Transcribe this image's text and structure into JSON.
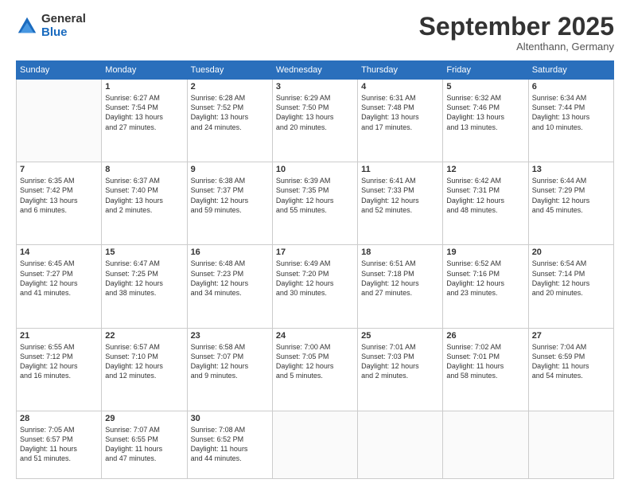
{
  "logo": {
    "general": "General",
    "blue": "Blue"
  },
  "header": {
    "month": "September 2025",
    "location": "Altenthann, Germany"
  },
  "weekdays": [
    "Sunday",
    "Monday",
    "Tuesday",
    "Wednesday",
    "Thursday",
    "Friday",
    "Saturday"
  ],
  "weeks": [
    [
      {
        "day": "",
        "info": ""
      },
      {
        "day": "1",
        "info": "Sunrise: 6:27 AM\nSunset: 7:54 PM\nDaylight: 13 hours\nand 27 minutes."
      },
      {
        "day": "2",
        "info": "Sunrise: 6:28 AM\nSunset: 7:52 PM\nDaylight: 13 hours\nand 24 minutes."
      },
      {
        "day": "3",
        "info": "Sunrise: 6:29 AM\nSunset: 7:50 PM\nDaylight: 13 hours\nand 20 minutes."
      },
      {
        "day": "4",
        "info": "Sunrise: 6:31 AM\nSunset: 7:48 PM\nDaylight: 13 hours\nand 17 minutes."
      },
      {
        "day": "5",
        "info": "Sunrise: 6:32 AM\nSunset: 7:46 PM\nDaylight: 13 hours\nand 13 minutes."
      },
      {
        "day": "6",
        "info": "Sunrise: 6:34 AM\nSunset: 7:44 PM\nDaylight: 13 hours\nand 10 minutes."
      }
    ],
    [
      {
        "day": "7",
        "info": "Sunrise: 6:35 AM\nSunset: 7:42 PM\nDaylight: 13 hours\nand 6 minutes."
      },
      {
        "day": "8",
        "info": "Sunrise: 6:37 AM\nSunset: 7:40 PM\nDaylight: 13 hours\nand 2 minutes."
      },
      {
        "day": "9",
        "info": "Sunrise: 6:38 AM\nSunset: 7:37 PM\nDaylight: 12 hours\nand 59 minutes."
      },
      {
        "day": "10",
        "info": "Sunrise: 6:39 AM\nSunset: 7:35 PM\nDaylight: 12 hours\nand 55 minutes."
      },
      {
        "day": "11",
        "info": "Sunrise: 6:41 AM\nSunset: 7:33 PM\nDaylight: 12 hours\nand 52 minutes."
      },
      {
        "day": "12",
        "info": "Sunrise: 6:42 AM\nSunset: 7:31 PM\nDaylight: 12 hours\nand 48 minutes."
      },
      {
        "day": "13",
        "info": "Sunrise: 6:44 AM\nSunset: 7:29 PM\nDaylight: 12 hours\nand 45 minutes."
      }
    ],
    [
      {
        "day": "14",
        "info": "Sunrise: 6:45 AM\nSunset: 7:27 PM\nDaylight: 12 hours\nand 41 minutes."
      },
      {
        "day": "15",
        "info": "Sunrise: 6:47 AM\nSunset: 7:25 PM\nDaylight: 12 hours\nand 38 minutes."
      },
      {
        "day": "16",
        "info": "Sunrise: 6:48 AM\nSunset: 7:23 PM\nDaylight: 12 hours\nand 34 minutes."
      },
      {
        "day": "17",
        "info": "Sunrise: 6:49 AM\nSunset: 7:20 PM\nDaylight: 12 hours\nand 30 minutes."
      },
      {
        "day": "18",
        "info": "Sunrise: 6:51 AM\nSunset: 7:18 PM\nDaylight: 12 hours\nand 27 minutes."
      },
      {
        "day": "19",
        "info": "Sunrise: 6:52 AM\nSunset: 7:16 PM\nDaylight: 12 hours\nand 23 minutes."
      },
      {
        "day": "20",
        "info": "Sunrise: 6:54 AM\nSunset: 7:14 PM\nDaylight: 12 hours\nand 20 minutes."
      }
    ],
    [
      {
        "day": "21",
        "info": "Sunrise: 6:55 AM\nSunset: 7:12 PM\nDaylight: 12 hours\nand 16 minutes."
      },
      {
        "day": "22",
        "info": "Sunrise: 6:57 AM\nSunset: 7:10 PM\nDaylight: 12 hours\nand 12 minutes."
      },
      {
        "day": "23",
        "info": "Sunrise: 6:58 AM\nSunset: 7:07 PM\nDaylight: 12 hours\nand 9 minutes."
      },
      {
        "day": "24",
        "info": "Sunrise: 7:00 AM\nSunset: 7:05 PM\nDaylight: 12 hours\nand 5 minutes."
      },
      {
        "day": "25",
        "info": "Sunrise: 7:01 AM\nSunset: 7:03 PM\nDaylight: 12 hours\nand 2 minutes."
      },
      {
        "day": "26",
        "info": "Sunrise: 7:02 AM\nSunset: 7:01 PM\nDaylight: 11 hours\nand 58 minutes."
      },
      {
        "day": "27",
        "info": "Sunrise: 7:04 AM\nSunset: 6:59 PM\nDaylight: 11 hours\nand 54 minutes."
      }
    ],
    [
      {
        "day": "28",
        "info": "Sunrise: 7:05 AM\nSunset: 6:57 PM\nDaylight: 11 hours\nand 51 minutes."
      },
      {
        "day": "29",
        "info": "Sunrise: 7:07 AM\nSunset: 6:55 PM\nDaylight: 11 hours\nand 47 minutes."
      },
      {
        "day": "30",
        "info": "Sunrise: 7:08 AM\nSunset: 6:52 PM\nDaylight: 11 hours\nand 44 minutes."
      },
      {
        "day": "",
        "info": ""
      },
      {
        "day": "",
        "info": ""
      },
      {
        "day": "",
        "info": ""
      },
      {
        "day": "",
        "info": ""
      }
    ]
  ]
}
